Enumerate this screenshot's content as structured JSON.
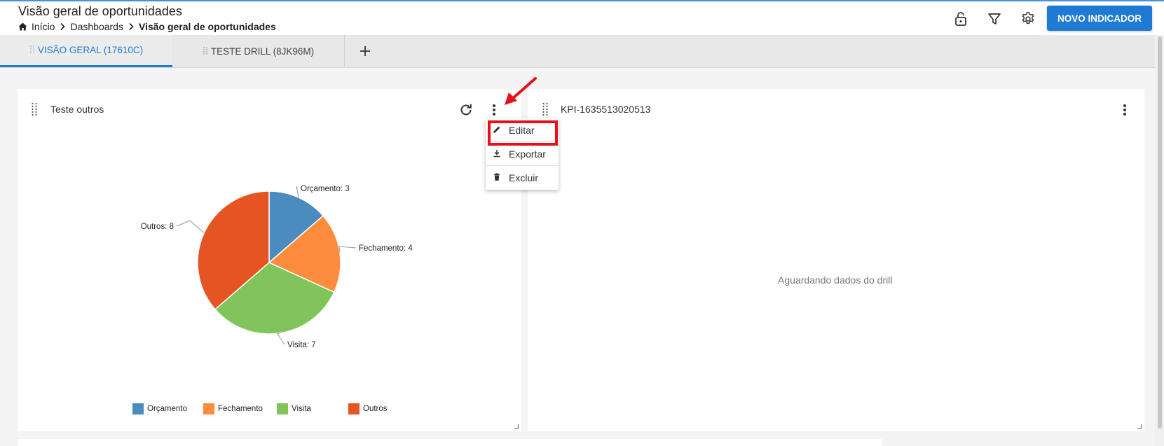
{
  "header": {
    "title": "Visão geral de oportunidades",
    "breadcrumb": {
      "home": "Início",
      "dashboards": "Dashboards",
      "current": "Visão geral de oportunidades"
    },
    "new_button": "NOVO INDICADOR",
    "icons": [
      "lock-icon",
      "filter-icon",
      "gear-icon"
    ]
  },
  "tabs": [
    {
      "label": "VISÃO GERAL (17610C)",
      "active": true
    },
    {
      "label": "TESTE DRILL (8JK96M)",
      "active": false
    }
  ],
  "card1": {
    "title": "Teste outros",
    "menu": [
      {
        "label": "Editar",
        "icon": "pencil-icon"
      },
      {
        "label": "Exportar",
        "icon": "download-icon"
      },
      {
        "label": "Excluir",
        "icon": "trash-icon"
      }
    ]
  },
  "card2": {
    "title": "KPI-1635513020513",
    "message": "Aguardando dados do drill"
  },
  "chart_data": {
    "type": "pie",
    "categories": [
      "Orçamento",
      "Fechamento",
      "Visita",
      "Outros"
    ],
    "values": [
      3,
      4,
      7,
      8
    ],
    "data_labels": [
      "Orçamento: 3",
      "Fechamento: 4",
      "Visita: 7",
      "Outros: 8"
    ],
    "colors": [
      "#4b8bbe",
      "#fd8d3c",
      "#82c45c",
      "#e55523"
    ],
    "legend": "bottom"
  }
}
